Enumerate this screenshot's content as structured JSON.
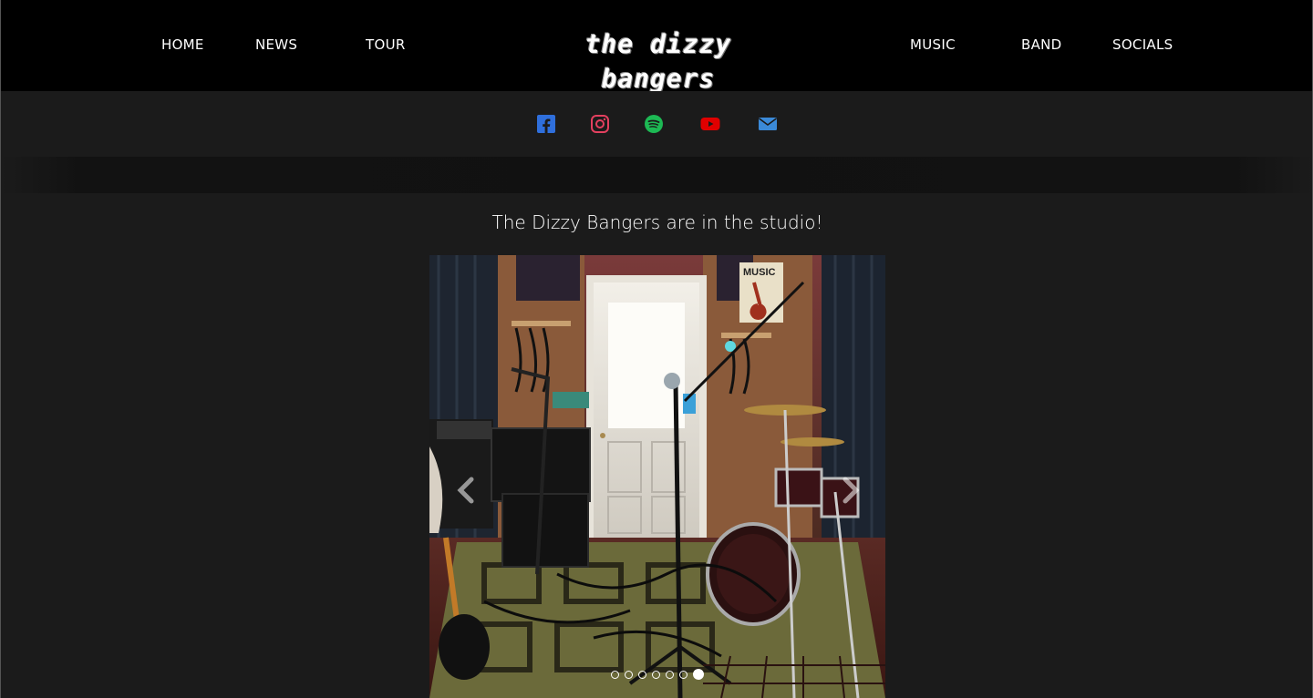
{
  "brand": {
    "logo_text": "the dizzy bangers"
  },
  "nav": {
    "left": [
      {
        "label": "HOME"
      },
      {
        "label": "NEWS"
      },
      {
        "label": "TOUR"
      }
    ],
    "right": [
      {
        "label": "MUSIC"
      },
      {
        "label": "BAND"
      },
      {
        "label": "SOCIALS"
      }
    ]
  },
  "socials": [
    {
      "icon": "facebook-icon",
      "color": "#2f6fdc"
    },
    {
      "icon": "instagram-icon",
      "color": "#e4405f"
    },
    {
      "icon": "spotify-icon",
      "color": "#1db954"
    },
    {
      "icon": "youtube-icon",
      "color": "#e00000"
    },
    {
      "icon": "email-icon",
      "color": "#3b8ad8"
    }
  ],
  "main": {
    "headline": "The Dizzy Bangers are in the studio!"
  },
  "carousel": {
    "slide_count": 7,
    "active_index": 6,
    "image_description_icon": "studio-photo"
  },
  "colors": {
    "header_bg": "#000000",
    "page_bg": "#1b1b1b",
    "text": "#ffffff"
  }
}
